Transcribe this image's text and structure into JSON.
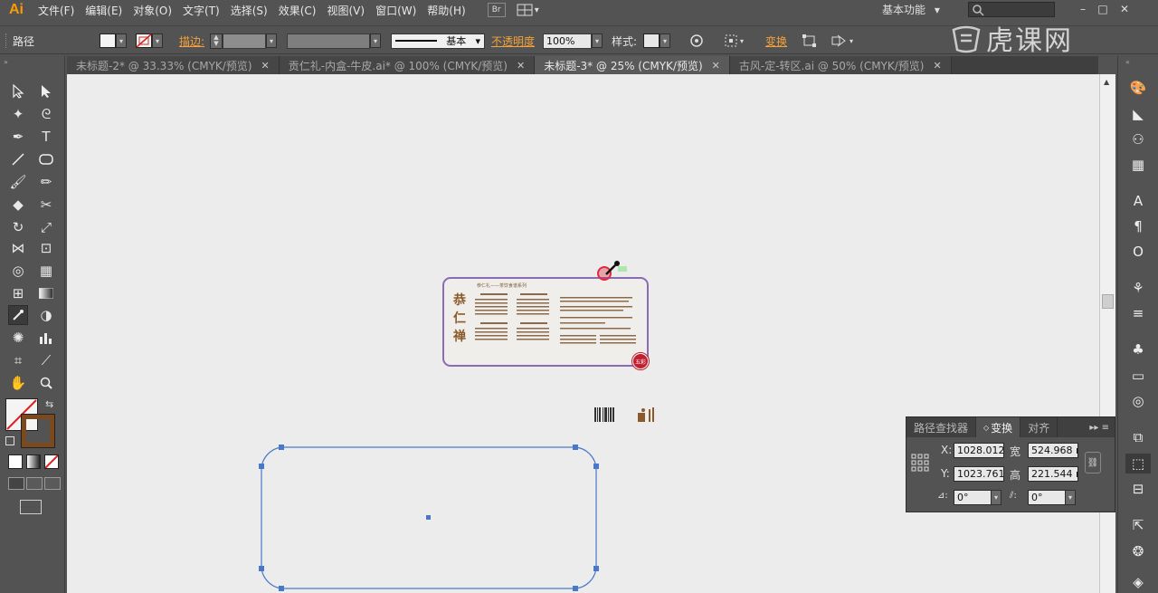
{
  "app": {
    "logo": "Ai"
  },
  "menu": [
    "文件(F)",
    "编辑(E)",
    "对象(O)",
    "文字(T)",
    "选择(S)",
    "效果(C)",
    "视图(V)",
    "窗口(W)",
    "帮助(H)"
  ],
  "menu_right": {
    "bridge": "Br",
    "workspace": "基本功能",
    "workspace_arrow": "▾"
  },
  "window_controls": {
    "minimize": "–",
    "maximize": "□",
    "close": "✕"
  },
  "control_bar": {
    "selection_type": "路径",
    "stroke_label": "描边:",
    "stroke_profile": "基本",
    "opacity_label": "不透明度",
    "opacity_value": "100%",
    "style_label": "样式:",
    "transform_label": "变换"
  },
  "watermark": {
    "text": "虎课网"
  },
  "tabs": [
    {
      "label": "未标题-2* @ 33.33% (CMYK/预览)",
      "close": "✕"
    },
    {
      "label": "贡仁礼-内盒-牛皮.ai* @ 100% (CMYK/预览)",
      "close": "✕"
    },
    {
      "label": "未标题-3* @ 25% (CMYK/预览)",
      "close": "✕"
    },
    {
      "label": "古风-定-转区.ai @ 50% (CMYK/预览)",
      "close": "✕"
    }
  ],
  "canvas": {
    "card_title": "恭仁禅",
    "card_header": "恭仁礼——茶饮食谱系列",
    "seal_text": "五彩"
  },
  "transform_panel": {
    "tabs": [
      "路径查找器",
      "变换",
      "对齐"
    ],
    "x_label": "X:",
    "x_value": "1028.012",
    "y_label": "Y:",
    "y_value": "1023.761",
    "w_label": "宽",
    "w_value": "524.968 r",
    "h_label": "高",
    "h_value": "221.544 r",
    "rotate_value": "0°",
    "shear_value": "0°"
  },
  "colors": {
    "accent_orange": "#f3a23c",
    "selection_blue": "#4a78c8",
    "card_border": "#8a6bb4",
    "seal_red": "#c02030"
  }
}
